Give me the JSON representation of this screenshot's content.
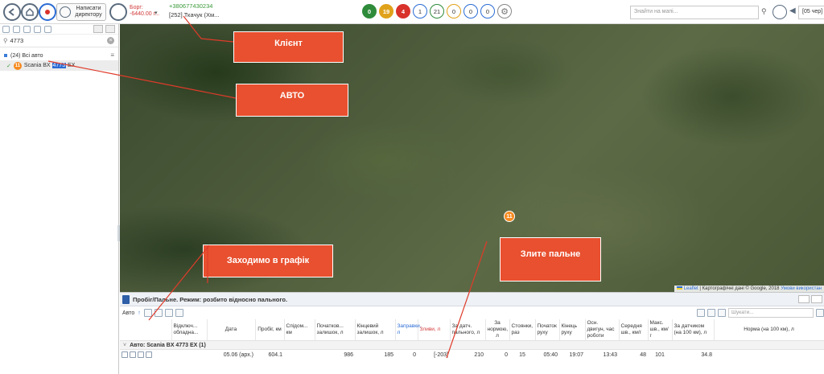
{
  "toolbar": {
    "director_label": "Написати директору",
    "debt_label": "Борг:",
    "debt_value": "-6440.00 г...",
    "client_phone": "+380677430234",
    "client_name": "[252] Ткачук (Хм...",
    "badges": [
      {
        "value": "0",
        "color": "#2e8b3a",
        "style": "filled"
      },
      {
        "value": "19",
        "color": "#e0a21a",
        "style": "filled"
      },
      {
        "value": "4",
        "color": "#d8322b",
        "style": "filled"
      },
      {
        "value": "1",
        "color": "#2b6cd4",
        "style": "outline"
      },
      {
        "value": "21",
        "color": "#2e8b3a",
        "style": "outline"
      },
      {
        "value": "0",
        "color": "#e0a21a",
        "style": "outline"
      },
      {
        "value": "0",
        "color": "#2b6cd4",
        "style": "outline"
      },
      {
        "value": "0",
        "color": "#2b6cd4",
        "style": "outline"
      }
    ],
    "map_search_placeholder": "Знайти на мапі...",
    "date_value": "[05 чер]"
  },
  "sidebar": {
    "search_value": "4773",
    "group_label": "(24) Всі авто",
    "vehicle": {
      "badge": "11",
      "prefix": "Scania BX ",
      "highlight": "4773",
      "suffix": " EX"
    }
  },
  "map": {
    "marker_label": "11",
    "attribution_leaflet": "Leaflet",
    "attribution_text": " | Картографічні дані © Google, 2018 ",
    "attribution_link": "Умови використан",
    "callouts": {
      "client": "Клієнт",
      "avto": "АВТО",
      "graph": "Заходимо в графік",
      "fuel": "Злите пальне"
    }
  },
  "report": {
    "title": "Пробіг/Пальне. Режим: розбито відносно пального.",
    "auto_label": "Авто",
    "search_placeholder": "Шукати...",
    "columns": [
      "Відключ... обладна...",
      "Дата",
      "Пробіг, км",
      "Спідом... км",
      "Початков... залишок, л",
      "Кінцевий залишок, л",
      "Заправки, л",
      "Зливи, л",
      "За датч. пального, л",
      "За нормою, л",
      "Стоянки, раз",
      "Початок руху",
      "Кінець руху",
      "Осн. двигун, час роботи",
      "Середня шв., км/г",
      "Макс. шв., км/г",
      "За датчиком (на 100 км), л",
      "Норма (на 100 км), л"
    ],
    "group_row": "Авто: Scania BX 4773 EX (1)",
    "row": {
      "date": "05.06 (арх.)",
      "mileage": "604.1",
      "speedometer": "",
      "start_fuel": "986",
      "end_fuel": "185",
      "refuel": "0",
      "drain": "[-203]",
      "by_sensor": "210",
      "by_norm": "0",
      "stops": "15",
      "move_start": "05:40",
      "move_end": "19:07",
      "engine_time": "13:43",
      "avg_speed": "48",
      "max_speed": "101",
      "sensor_per100": "34.8",
      "norm_per100": ""
    }
  }
}
